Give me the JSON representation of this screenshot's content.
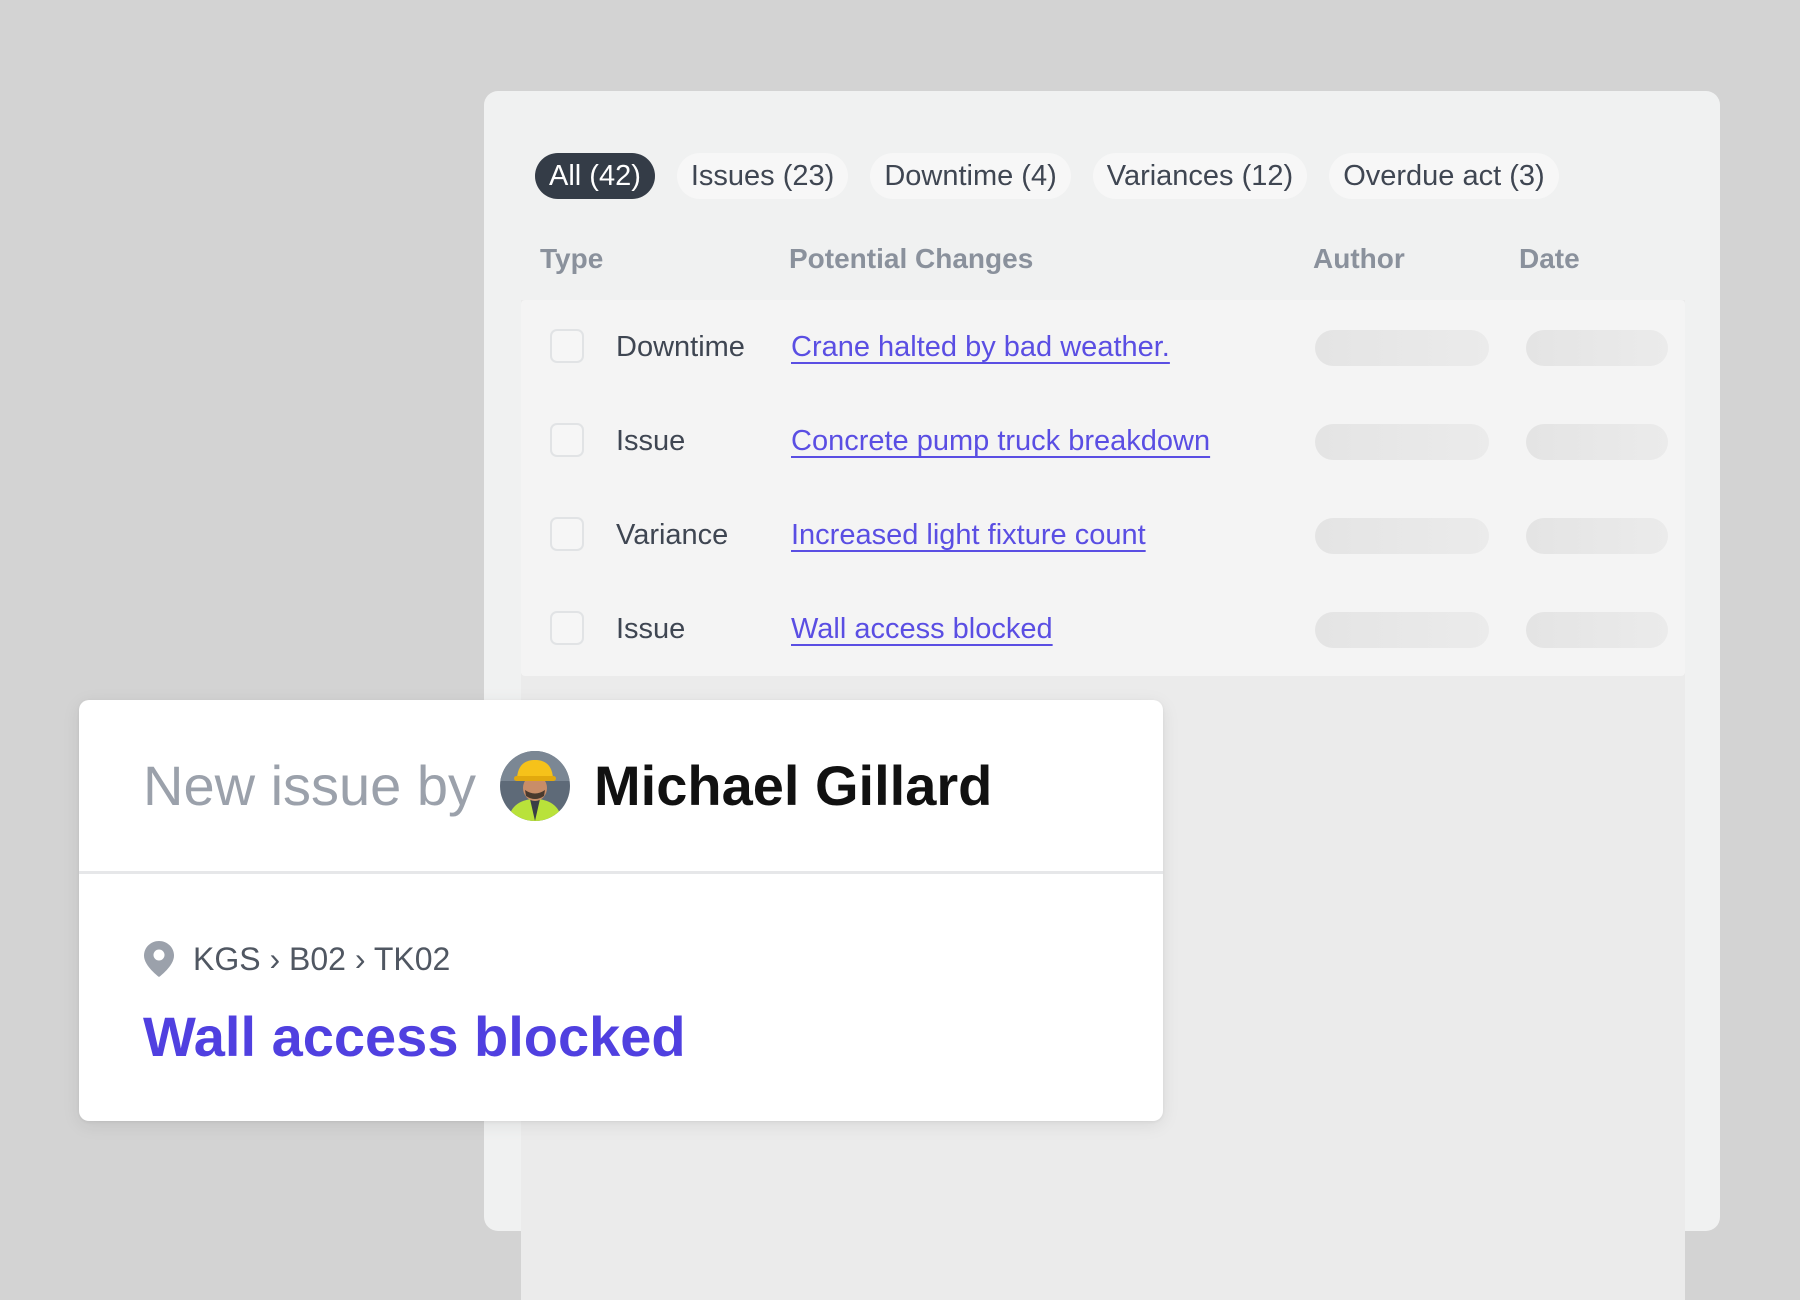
{
  "filters": [
    {
      "label": "All (42)",
      "active": true
    },
    {
      "label": "Issues (23)",
      "active": false
    },
    {
      "label": "Downtime (4)",
      "active": false
    },
    {
      "label": "Variances (12)",
      "active": false
    },
    {
      "label": "Overdue act (3)",
      "active": false
    }
  ],
  "table": {
    "headers": {
      "type": "Type",
      "changes": "Potential Changes",
      "author": "Author",
      "date": "Date"
    },
    "rows": [
      {
        "type": "Downtime",
        "change": "Crane halted by bad weather."
      },
      {
        "type": "Issue",
        "change": "Concrete pump truck breakdown"
      },
      {
        "type": "Variance",
        "change": "Increased light fixture count"
      },
      {
        "type": "Issue",
        "change": "Wall access blocked"
      }
    ]
  },
  "notification": {
    "prefix": "New issue by",
    "author": "Michael Gillard",
    "location": "KGS › B02 › TK02",
    "title": "Wall access blocked"
  },
  "icons": {
    "avatar": "worker-avatar",
    "location": "location-pin-icon"
  },
  "colors": {
    "background": "#d3d3d3",
    "panel": "#f0f1f1",
    "active_chip": "#343c47",
    "link": "#5a4ee3",
    "card_title": "#5040e0"
  }
}
